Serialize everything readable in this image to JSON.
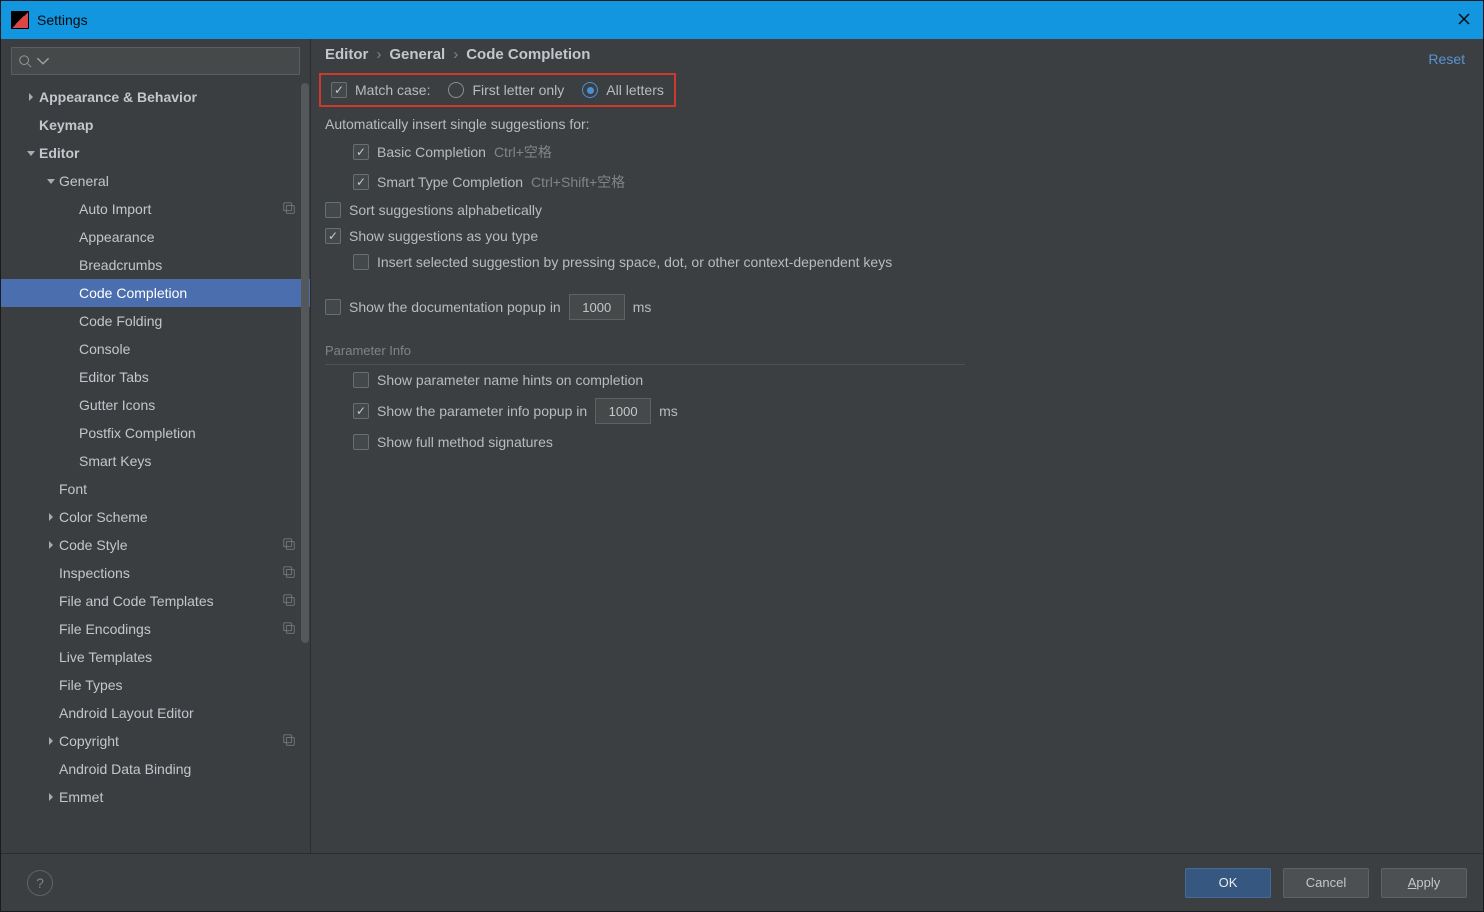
{
  "window": {
    "title": "Settings"
  },
  "sidebar": {
    "items": [
      {
        "label": "Appearance & Behavior",
        "bold": true,
        "arrow": "right",
        "depth": 0
      },
      {
        "label": "Keymap",
        "bold": true,
        "depth": 0
      },
      {
        "label": "Editor",
        "bold": true,
        "arrow": "down",
        "depth": 0
      },
      {
        "label": "General",
        "arrow": "down",
        "depth": 1
      },
      {
        "label": "Auto Import",
        "depth": 2,
        "badge": true
      },
      {
        "label": "Appearance",
        "depth": 2
      },
      {
        "label": "Breadcrumbs",
        "depth": 2
      },
      {
        "label": "Code Completion",
        "depth": 2,
        "selected": true
      },
      {
        "label": "Code Folding",
        "depth": 2
      },
      {
        "label": "Console",
        "depth": 2
      },
      {
        "label": "Editor Tabs",
        "depth": 2
      },
      {
        "label": "Gutter Icons",
        "depth": 2
      },
      {
        "label": "Postfix Completion",
        "depth": 2
      },
      {
        "label": "Smart Keys",
        "depth": 2
      },
      {
        "label": "Font",
        "depth": 1
      },
      {
        "label": "Color Scheme",
        "arrow": "right",
        "depth": 1
      },
      {
        "label": "Code Style",
        "arrow": "right",
        "depth": 1,
        "badge": true
      },
      {
        "label": "Inspections",
        "depth": 1,
        "badge": true
      },
      {
        "label": "File and Code Templates",
        "depth": 1,
        "badge": true
      },
      {
        "label": "File Encodings",
        "depth": 1,
        "badge": true
      },
      {
        "label": "Live Templates",
        "depth": 1
      },
      {
        "label": "File Types",
        "depth": 1
      },
      {
        "label": "Android Layout Editor",
        "depth": 1
      },
      {
        "label": "Copyright",
        "arrow": "right",
        "depth": 1,
        "badge": true
      },
      {
        "label": "Android Data Binding",
        "depth": 1
      },
      {
        "label": "Emmet",
        "arrow": "right",
        "depth": 1
      }
    ]
  },
  "breadcrumb": {
    "parts": [
      "Editor",
      "General",
      "Code Completion"
    ],
    "separator": "›"
  },
  "reset": "Reset",
  "form": {
    "match_case": {
      "label": "Match case:",
      "checked": true,
      "opt1": "First letter only",
      "opt2": "All letters",
      "selected": "opt2"
    },
    "auto_insert_label": "Automatically insert single suggestions for:",
    "basic": {
      "label": "Basic Completion",
      "hint": "Ctrl+空格",
      "checked": true
    },
    "smart": {
      "label": "Smart Type Completion",
      "hint": "Ctrl+Shift+空格",
      "checked": true
    },
    "sort_alpha": {
      "label": "Sort suggestions alphabetically",
      "checked": false
    },
    "suggest_type": {
      "label": "Show suggestions as you type",
      "checked": true
    },
    "insert_selected": {
      "label": "Insert selected suggestion by pressing space, dot, or other context-dependent keys",
      "checked": false
    },
    "doc_popup": {
      "label_pre": "Show the documentation popup in",
      "value": "1000",
      "label_post": "ms",
      "checked": false
    },
    "section_param": "Parameter Info",
    "param_hints": {
      "label": "Show parameter name hints on completion",
      "checked": false
    },
    "param_popup": {
      "label_pre": "Show the parameter info popup in",
      "value": "1000",
      "label_post": "ms",
      "checked": true
    },
    "full_sig": {
      "label": "Show full method signatures",
      "checked": false
    }
  },
  "footer": {
    "help": "?",
    "ok": "OK",
    "cancel": "Cancel",
    "apply": "Apply"
  }
}
